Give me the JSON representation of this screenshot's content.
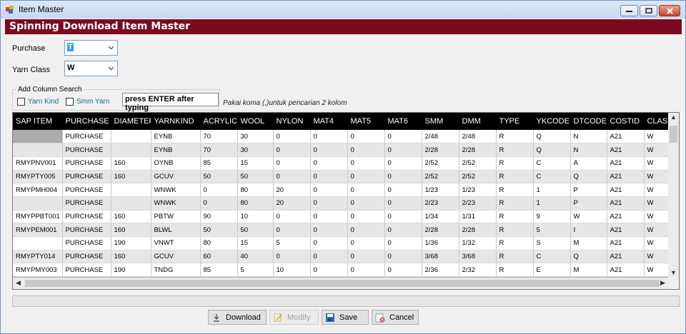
{
  "window": {
    "title": "Item Master"
  },
  "header": {
    "title": "Spinning Download Item Master"
  },
  "filters": {
    "purchase_label": "Purchase",
    "purchase_value": "T",
    "yarn_class_label": "Yarn Class",
    "yarn_class_value": "W"
  },
  "column_search": {
    "group_title": "Add Column Search",
    "yarn_kind_label": "Yarn Kind",
    "smm_yarn_label": "Smm Yarn",
    "type_value": "press ENTER after typing",
    "hint": "Pakai koma (,)untuk pencarian 2 kolom"
  },
  "grid": {
    "columns": [
      "SAP ITEM",
      "PURCHASE",
      "DIAMETER",
      "YARNKIND",
      "ACRYLIC",
      "WOOL",
      "NYLON",
      "MAT4",
      "MAT5",
      "MAT6",
      "SMM",
      "DMM",
      "TYPE",
      "YKCODE",
      "DTCODE",
      "COSTID",
      "CLASS"
    ],
    "rows": [
      [
        "",
        "PURCHASE",
        "",
        "EYNB",
        "70",
        "30",
        "0",
        "0",
        "0",
        "0",
        "2/48",
        "2/48",
        "R",
        "Q",
        "N",
        "A21",
        "W"
      ],
      [
        "",
        "PURCHASE",
        "",
        "EYNB",
        "70",
        "30",
        "0",
        "0",
        "0",
        "0",
        "2/28",
        "2/28",
        "R",
        "Q",
        "N",
        "A21",
        "W"
      ],
      [
        "RMYPNV001",
        "PURCHASE",
        "160",
        "OYNB",
        "85",
        "15",
        "0",
        "0",
        "0",
        "0",
        "2/52",
        "2/52",
        "R",
        "C",
        "A",
        "A21",
        "W"
      ],
      [
        "RMYPTY005",
        "PURCHASE",
        "160",
        "GCUV",
        "50",
        "50",
        "0",
        "0",
        "0",
        "0",
        "2/52",
        "2/52",
        "R",
        "C",
        "Q",
        "A21",
        "W"
      ],
      [
        "RMYPMH004",
        "PURCHASE",
        "",
        "WNWK",
        "0",
        "80",
        "20",
        "0",
        "0",
        "0",
        "1/23",
        "1/23",
        "R",
        "1",
        "P",
        "A21",
        "W"
      ],
      [
        "",
        "PURCHASE",
        "",
        "WNWK",
        "0",
        "80",
        "20",
        "0",
        "0",
        "0",
        "2/23",
        "2/23",
        "R",
        "1",
        "P",
        "A21",
        "W"
      ],
      [
        "RMYPPBT001",
        "PURCHASE",
        "160",
        "PBTW",
        "90",
        "10",
        "0",
        "0",
        "0",
        "0",
        "1/34",
        "1/31",
        "R",
        "9",
        "W",
        "A21",
        "W"
      ],
      [
        "RMYPEM001",
        "PURCHASE",
        "160",
        "BLWL",
        "50",
        "50",
        "0",
        "0",
        "0",
        "0",
        "2/28",
        "2/28",
        "R",
        "5",
        "I",
        "A21",
        "W"
      ],
      [
        "",
        "PURCHASE",
        "190",
        "VNWT",
        "80",
        "15",
        "5",
        "0",
        "0",
        "0",
        "1/36",
        "1/32",
        "R",
        "S",
        "M",
        "A21",
        "W"
      ],
      [
        "RMYPTY014",
        "PURCHASE",
        "160",
        "GCUV",
        "60",
        "40",
        "0",
        "0",
        "0",
        "0",
        "3/68",
        "3/68",
        "R",
        "C",
        "Q",
        "A21",
        "W"
      ],
      [
        "RMYPMY003",
        "PURCHASE",
        "190",
        "TNDG",
        "85",
        "5",
        "10",
        "0",
        "0",
        "0",
        "2/36",
        "2/32",
        "R",
        "E",
        "M",
        "A21",
        "W"
      ]
    ]
  },
  "buttons": {
    "download": "Download",
    "modify": "Modify",
    "save": "Save",
    "cancel": "Cancel"
  },
  "colors": {
    "header_band": "#7c0a1f",
    "grid_header": "#000000",
    "row_alt": "#e6e6e6"
  }
}
